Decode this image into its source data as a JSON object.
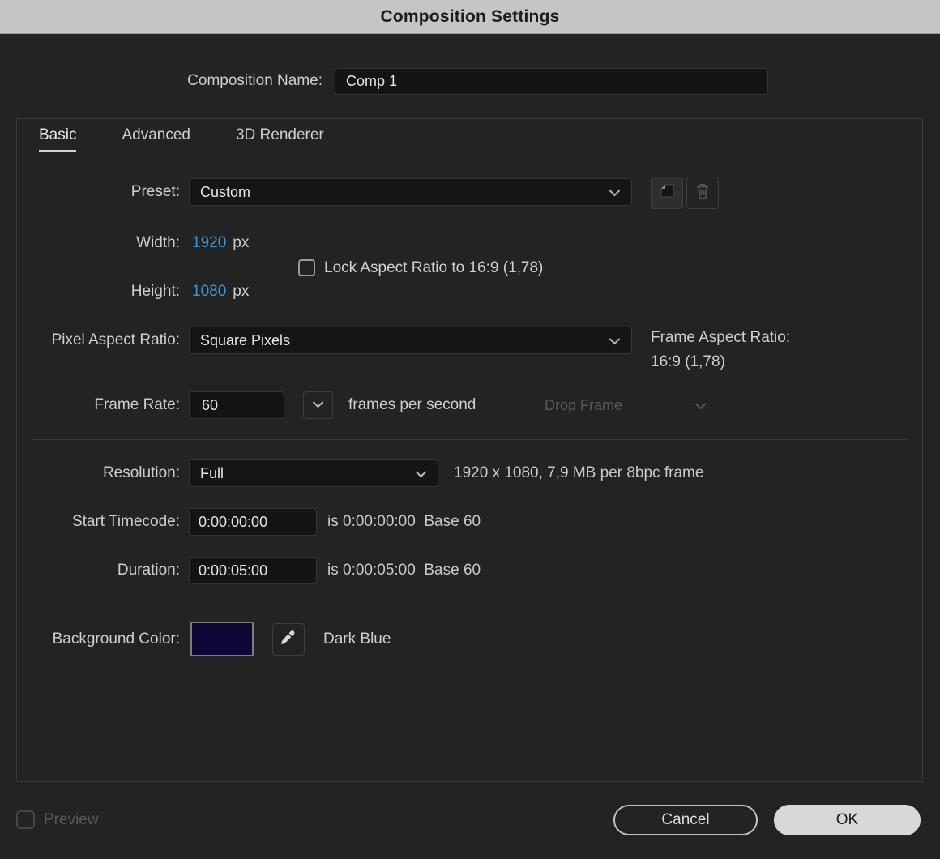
{
  "window": {
    "title": "Composition Settings"
  },
  "composition_name": {
    "label": "Composition Name:",
    "value": "Comp 1"
  },
  "tabs": {
    "basic": "Basic",
    "advanced": "Advanced",
    "renderer": "3D Renderer"
  },
  "basic": {
    "preset": {
      "label": "Preset:",
      "value": "Custom"
    },
    "width": {
      "label": "Width:",
      "value": "1920",
      "unit": "px"
    },
    "height": {
      "label": "Height:",
      "value": "1080",
      "unit": "px"
    },
    "lock_aspect": {
      "label": "Lock Aspect Ratio to 16:9 (1,78)",
      "checked": false
    },
    "pixel_aspect_ratio": {
      "label": "Pixel Aspect Ratio:",
      "value": "Square Pixels"
    },
    "frame_aspect_ratio": {
      "label": "Frame Aspect Ratio:",
      "value": "16:9 (1,78)"
    },
    "frame_rate": {
      "label": "Frame Rate:",
      "value": "60",
      "suffix": "frames per second",
      "drop_frame_value": "Drop Frame"
    },
    "resolution": {
      "label": "Resolution:",
      "value": "Full",
      "info": "1920 x 1080, 7,9 MB per 8bpc frame"
    },
    "start_timecode": {
      "label": "Start Timecode:",
      "value": "0:00:00:00",
      "info": "is 0:00:00:00  Base 60"
    },
    "duration": {
      "label": "Duration:",
      "value": "0:00:05:00",
      "info": "is 0:00:05:00  Base 60"
    },
    "background_color": {
      "label": "Background Color:",
      "name": "Dark Blue",
      "swatch_hex": "#0e0836"
    }
  },
  "footer": {
    "preview": "Preview",
    "cancel": "Cancel",
    "ok": "OK"
  },
  "colors": {
    "value_blue": "#3d96dc",
    "titlebar_bg": "#c5c5c5",
    "dialog_bg": "#232323"
  },
  "icons": [
    "chevron-down-icon",
    "save-preset-icon",
    "trash-icon",
    "eyedropper-icon",
    "checkbox"
  ]
}
